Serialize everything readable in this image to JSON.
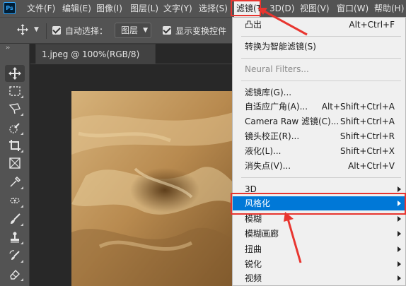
{
  "app": {
    "logo_text": "Ps"
  },
  "menubar": {
    "items": [
      {
        "label": "文件(F)"
      },
      {
        "label": "编辑(E)"
      },
      {
        "label": "图像(I)"
      },
      {
        "label": "图层(L)"
      },
      {
        "label": "文字(Y)"
      },
      {
        "label": "选择(S)"
      },
      {
        "label": "滤镜(T)"
      },
      {
        "label": "3D(D)"
      },
      {
        "label": "视图(V)"
      },
      {
        "label": "窗口(W)"
      },
      {
        "label": "帮助(H)"
      }
    ],
    "active_item": "滤镜(T)"
  },
  "options_bar": {
    "auto_select_label": "自动选择：",
    "auto_select_checked": true,
    "auto_select_target": "图层",
    "show_transform_label": "显示变换控件",
    "show_transform_checked": true
  },
  "tools": [
    {
      "icon": "move-tool-icon"
    },
    {
      "icon": "marquee-tool-icon"
    },
    {
      "icon": "lasso-tool-icon"
    },
    {
      "icon": "quick-select-tool-icon"
    },
    {
      "icon": "crop-tool-icon"
    },
    {
      "icon": "frame-tool-icon"
    },
    {
      "icon": "eyedropper-tool-icon"
    },
    {
      "icon": "healing-brush-tool-icon"
    },
    {
      "icon": "brush-tool-icon"
    },
    {
      "icon": "clone-stamp-tool-icon"
    },
    {
      "icon": "history-brush-tool-icon"
    },
    {
      "icon": "eraser-tool-icon"
    }
  ],
  "document": {
    "tab_title": "1.jpeg @ 100%(RGB/8)",
    "canvas_color": "#b88a4f"
  },
  "filter_menu": {
    "items": [
      {
        "label": "凸出",
        "shortcut": "Alt+Ctrl+F",
        "state": "normal"
      },
      {
        "label": "转换为智能滤镜(S)",
        "shortcut": "",
        "state": "normal"
      },
      {
        "label": "Neural Filters...",
        "shortcut": "",
        "state": "disabled"
      },
      {
        "label": "滤镜库(G)...",
        "shortcut": "",
        "state": "normal"
      },
      {
        "label": "自适应广角(A)...",
        "shortcut": "Alt+Shift+Ctrl+A",
        "state": "normal"
      },
      {
        "label": "Camera Raw 滤镜(C)...",
        "shortcut": "Shift+Ctrl+A",
        "state": "normal"
      },
      {
        "label": "镜头校正(R)...",
        "shortcut": "Shift+Ctrl+R",
        "state": "normal"
      },
      {
        "label": "液化(L)...",
        "shortcut": "Shift+Ctrl+X",
        "state": "normal"
      },
      {
        "label": "消失点(V)...",
        "shortcut": "Alt+Ctrl+V",
        "state": "normal"
      },
      {
        "label": "3D",
        "shortcut": "",
        "state": "submenu"
      },
      {
        "label": "风格化",
        "shortcut": "",
        "state": "highlighted-submenu"
      },
      {
        "label": "模糊",
        "shortcut": "",
        "state": "submenu"
      },
      {
        "label": "模糊画廊",
        "shortcut": "",
        "state": "submenu"
      },
      {
        "label": "扭曲",
        "shortcut": "",
        "state": "submenu"
      },
      {
        "label": "锐化",
        "shortcut": "",
        "state": "submenu"
      },
      {
        "label": "视频",
        "shortcut": "",
        "state": "submenu"
      }
    ]
  },
  "colors": {
    "chrome": "#535353",
    "workspace": "#282828",
    "menu_bg": "#f0f0f0",
    "highlight": "#0078d7",
    "annotation_red": "#e8352f"
  }
}
